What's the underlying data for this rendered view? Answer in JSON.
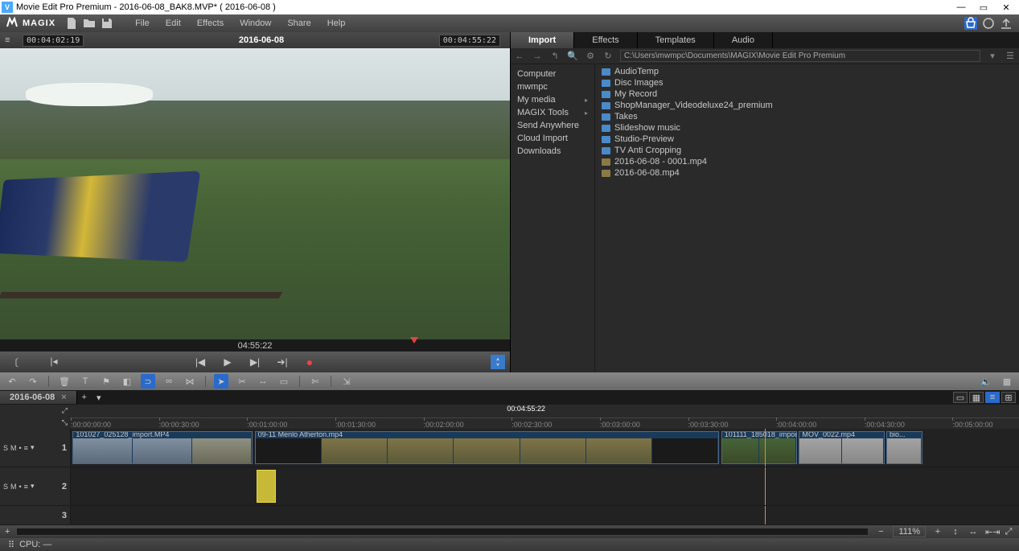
{
  "window": {
    "title": "Movie Edit Pro Premium - 2016-06-08_BAK8.MVP* ( 2016-06-08 )"
  },
  "brand": "MAGIX",
  "menu": [
    "File",
    "Edit",
    "Effects",
    "Window",
    "Share",
    "Help"
  ],
  "preview": {
    "tc_in": "00:04:02:19",
    "title": "2016-06-08",
    "tc_out": "00:04:55:22",
    "scrub_tc": "04:55:22"
  },
  "media_tabs": [
    "Import",
    "Effects",
    "Templates",
    "Audio"
  ],
  "media_tab_active": 0,
  "media_path": "C:\\Users\\mwmpc\\Documents\\MAGIX\\Movie Edit Pro Premium",
  "tree": [
    {
      "label": "Computer",
      "expand": false
    },
    {
      "label": "mwmpc",
      "expand": false
    },
    {
      "label": "My media",
      "expand": true
    },
    {
      "label": "MAGIX Tools",
      "expand": true
    },
    {
      "label": "Send Anywhere",
      "expand": false
    },
    {
      "label": "Cloud Import",
      "expand": false
    },
    {
      "label": "Downloads",
      "expand": false
    }
  ],
  "files": [
    {
      "label": "AudioTemp",
      "t": "folder"
    },
    {
      "label": "Disc Images",
      "t": "folder"
    },
    {
      "label": "My Record",
      "t": "folder"
    },
    {
      "label": "ShopManager_Videodeluxe24_premium",
      "t": "folder"
    },
    {
      "label": "Takes",
      "t": "folder"
    },
    {
      "label": "Slideshow music",
      "t": "folder"
    },
    {
      "label": "Studio-Preview",
      "t": "folder"
    },
    {
      "label": "TV Anti Cropping",
      "t": "folder"
    },
    {
      "label": "2016-06-08 - 0001.mp4",
      "t": "vid"
    },
    {
      "label": "2016-06-08.mp4",
      "t": "vid"
    }
  ],
  "project_tab": "2016-06-08",
  "ruler": {
    "playhead_tc": "00:04:55:22",
    "ticks": [
      {
        "l": ":00:00:00:00",
        "p": 0
      },
      {
        "l": ":00:00:30:00",
        "p": 9.3
      },
      {
        "l": ":00:01:00:00",
        "p": 18.6
      },
      {
        "l": ":00:01:30:00",
        "p": 27.9
      },
      {
        "l": ":00:02:00:00",
        "p": 37.2
      },
      {
        "l": ":00:02:30:00",
        "p": 46.5
      },
      {
        "l": ":00:03:00:00",
        "p": 55.8
      },
      {
        "l": ":00:03:30:00",
        "p": 65.1
      },
      {
        "l": ":00:04:00:00",
        "p": 74.4
      },
      {
        "l": ":00:04:30:00",
        "p": 83.7
      },
      {
        "l": ":00:05:00:00",
        "p": 93.0
      }
    ]
  },
  "playhead_pos": 73.2,
  "tracks": {
    "t1": {
      "label": "1",
      "clips": [
        {
          "name": "101027_025128_import.MP4",
          "l": 0.2,
          "w": 19,
          "th": [
            "t1",
            "t1",
            "t2"
          ]
        },
        {
          "name": "09-11 Menlo Atherton.mp4",
          "l": 19.4,
          "w": 49,
          "th": [
            "t3",
            "t4",
            "t4",
            "t4",
            "t4",
            "t4",
            "t3"
          ]
        },
        {
          "name": "101111_185018_impor...",
          "l": 68.6,
          "w": 8,
          "th": [
            "t5",
            "t5"
          ]
        },
        {
          "name": "MOV_0022.mp4",
          "l": 76.8,
          "w": 9,
          "th": [
            "t6",
            "t6"
          ]
        },
        {
          "name": "bio...",
          "l": 86,
          "w": 3.8,
          "th": [
            "t6"
          ]
        }
      ]
    },
    "t2": {
      "label": "2",
      "audio": {
        "l": 19.6,
        "w": 2.0
      }
    },
    "t3": {
      "label": "3"
    }
  },
  "track_buttons": [
    "S",
    "M",
    "•",
    "≡",
    "▾"
  ],
  "zoom": "111%",
  "status": {
    "cpu": "CPU: —"
  }
}
